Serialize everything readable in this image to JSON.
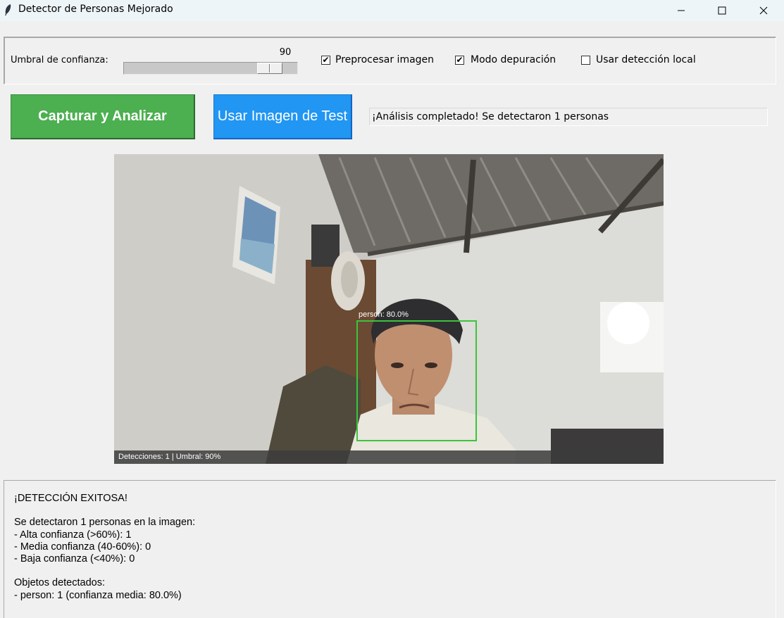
{
  "window": {
    "title": "Detector de Personas Mejorado",
    "icon": "feather-icon",
    "controls": [
      "minimize-icon",
      "maximize-icon",
      "close-icon"
    ]
  },
  "controls": {
    "threshold_label": "Umbral de confianza:",
    "threshold_value": "90",
    "threshold_fraction": 0.9,
    "checkboxes": [
      {
        "label": "Preprocesar imagen",
        "checked": true,
        "mark": "✔"
      },
      {
        "label": "Modo depuración",
        "checked": true,
        "mark": "✔"
      },
      {
        "label": "Usar detección local",
        "checked": false,
        "mark": ""
      }
    ]
  },
  "actions": {
    "capture_label": "Capturar y Analizar",
    "test_label": "Usar Imagen de Test",
    "capture_color": "#4caf50",
    "test_color": "#2196f3",
    "status": "¡Análisis completado! Se detectaron 1 personas"
  },
  "camera": {
    "detection_label": "person: 80.0%",
    "detection_color": "#3cc43c",
    "footer": "Detecciones: 1 | Umbral: 90%"
  },
  "results": {
    "lines": [
      "¡DETECCIÓN EXITOSA!",
      "",
      "Se detectaron 1 personas en la imagen:",
      "- Alta confianza (>60%): 1",
      "- Media confianza (40-60%): 0",
      "- Baja confianza (<40%): 0",
      "",
      "Objetos detectados:",
      "- person: 1 (confianza media: 80.0%)"
    ]
  }
}
